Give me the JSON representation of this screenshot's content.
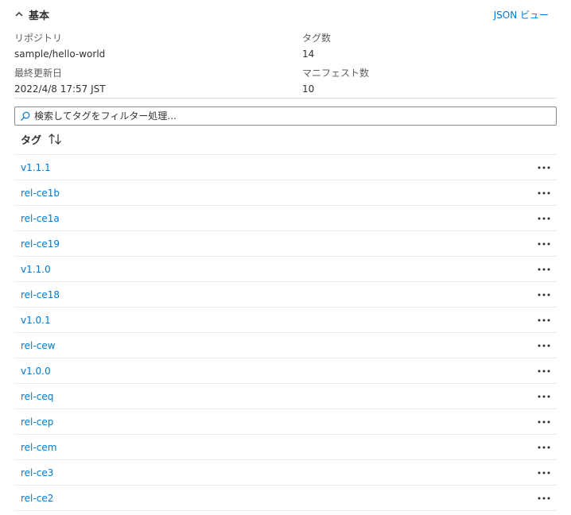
{
  "essentials": {
    "title": "基本",
    "json_view_label": "JSON ビュー",
    "repository_label": "リポジトリ",
    "repository_value": "sample/hello-world",
    "tag_count_label": "タグ数",
    "tag_count_value": "14",
    "last_updated_label": "最終更新日",
    "last_updated_value": "2022/4/8 17:57 JST",
    "manifest_count_label": "マニフェスト数",
    "manifest_count_value": "10"
  },
  "filter": {
    "placeholder": "検索してタグをフィルター処理..."
  },
  "table": {
    "column_header": "タグ",
    "rows": [
      {
        "tag": "v1.1.1"
      },
      {
        "tag": "rel-ce1b"
      },
      {
        "tag": "rel-ce1a"
      },
      {
        "tag": "rel-ce19"
      },
      {
        "tag": "v1.1.0"
      },
      {
        "tag": "rel-ce18"
      },
      {
        "tag": "v1.0.1"
      },
      {
        "tag": "rel-cew"
      },
      {
        "tag": "v1.0.0"
      },
      {
        "tag": "rel-ceq"
      },
      {
        "tag": "rel-cep"
      },
      {
        "tag": "rel-cem"
      },
      {
        "tag": "rel-ce3"
      },
      {
        "tag": "rel-ce2"
      }
    ]
  },
  "icons": {
    "collapse": "chevron-up-icon",
    "search": "search-icon",
    "sort": "sort-arrows-icon",
    "more": "more-ellipsis-icon"
  },
  "colors": {
    "link": "#0078d4",
    "text": "#323130",
    "border": "#8a8886",
    "row_divider": "#edebe9"
  }
}
